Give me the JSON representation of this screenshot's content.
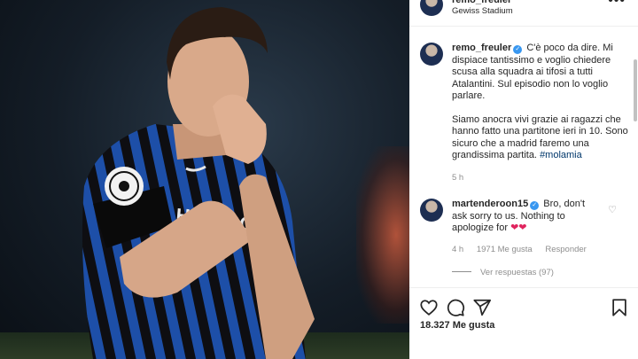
{
  "post": {
    "header": {
      "username": "remo_freuler",
      "location": "Gewiss Stadium",
      "more_icon": "more-horizontal-icon"
    },
    "caption": {
      "username": "remo_freuler",
      "paragraph1": "C'è poco da dire. Mi dispiace tantissimo e voglio chiedere scusa alla squadra ai tifosi a tutti Atalantini. Sul episodio non lo voglio parlare.",
      "paragraph2": "Siamo anocra vivi grazie ai ragazzi che hanno fatto una partitone ieri in 10. Sono sicuro che a madrid faremo una grandissima partita.",
      "hashtag": "#molamia",
      "time": "5 h"
    },
    "comment": {
      "username": "martenderoon15",
      "text": "Bro, don't ask sorry to us. Nothing to apologize for",
      "emoji": "❤❤",
      "time": "4 h",
      "likes": "1971 Me gusta",
      "reply_label": "Responder",
      "view_replies": "Ver respuestas (97)"
    },
    "likes_count": "18.327 Me gusta"
  },
  "colors": {
    "verified": "#3897f0",
    "hashtag": "#00376b",
    "heart": "#e0245e",
    "muted_text": "#8e8e8e"
  }
}
